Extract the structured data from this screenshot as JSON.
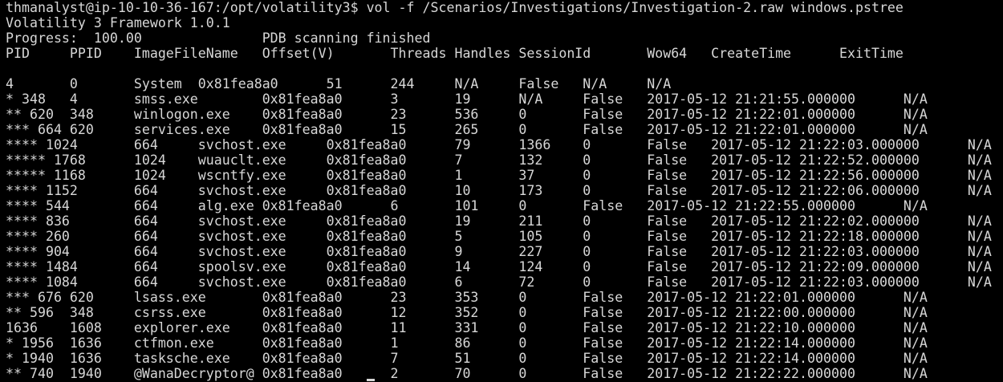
{
  "terminal": {
    "prompt_user_host_path": "thmanalyst@ip-10-10-36-167:/opt/volatility3$",
    "command": " vol -f /Scenarios/Investigations/Investigation-2.raw windows.pstree",
    "output_lines": [
      "Volatility 3 Framework 1.0.1",
      "Progress:  100.00               PDB scanning finished",
      "PID     PPID    ImageFileName   Offset(V)       Threads Handles SessionId       Wow64   CreateTime      ExitTime",
      "",
      "4       0       System  0x81fea8a0      51      244     N/A     False   N/A     N/A",
      "* 348   4       smss.exe        0x81fea8a0      3       19      N/A     False   2017-05-12 21:21:55.000000      N/A",
      "** 620  348     winlogon.exe    0x81fea8a0      23      536     0       False   2017-05-12 21:22:01.000000      N/A",
      "*** 664 620     services.exe    0x81fea8a0      15      265     0       False   2017-05-12 21:22:01.000000      N/A",
      "**** 1024       664     svchost.exe     0x81fea8a0      79      1366    0       False   2017-05-12 21:22:03.000000      N/A",
      "***** 1768      1024    wuauclt.exe     0x81fea8a0      7       132     0       False   2017-05-12 21:22:52.000000      N/A",
      "***** 1168      1024    wscntfy.exe     0x81fea8a0      1       37      0       False   2017-05-12 21:22:56.000000      N/A",
      "**** 1152       664     svchost.exe     0x81fea8a0      10      173     0       False   2017-05-12 21:22:06.000000      N/A",
      "**** 544        664     alg.exe 0x81fea8a0      6       101     0       False   2017-05-12 21:22:55.000000      N/A",
      "**** 836        664     svchost.exe     0x81fea8a0      19      211     0       False   2017-05-12 21:22:02.000000      N/A",
      "**** 260        664     svchost.exe     0x81fea8a0      5       105     0       False   2017-05-12 21:22:18.000000      N/A",
      "**** 904        664     svchost.exe     0x81fea8a0      9       227     0       False   2017-05-12 21:22:03.000000      N/A",
      "**** 1484       664     spoolsv.exe     0x81fea8a0      14      124     0       False   2017-05-12 21:22:09.000000      N/A",
      "**** 1084       664     svchost.exe     0x81fea8a0      6       72      0       False   2017-05-12 21:22:03.000000      N/A",
      "*** 676 620     lsass.exe       0x81fea8a0      23      353     0       False   2017-05-12 21:22:01.000000      N/A",
      "** 596  348     csrss.exe       0x81fea8a0      12      352     0       False   2017-05-12 21:22:00.000000      N/A",
      "1636    1608    explorer.exe    0x81fea8a0      11      331     0       False   2017-05-12 21:22:10.000000      N/A",
      "* 1956  1636    ctfmon.exe      0x81fea8a0      1       86      0       False   2017-05-12 21:22:14.000000      N/A",
      "* 1940  1636    tasksche.exe    0x81fea8a0      7       51      0       False   2017-05-12 21:22:14.000000      N/A",
      "** 740  1940    @WanaDecryptor@ 0x81fea8a0      2       70      0       False   2017-05-12 21:22:22.000000      N/A"
    ]
  }
}
